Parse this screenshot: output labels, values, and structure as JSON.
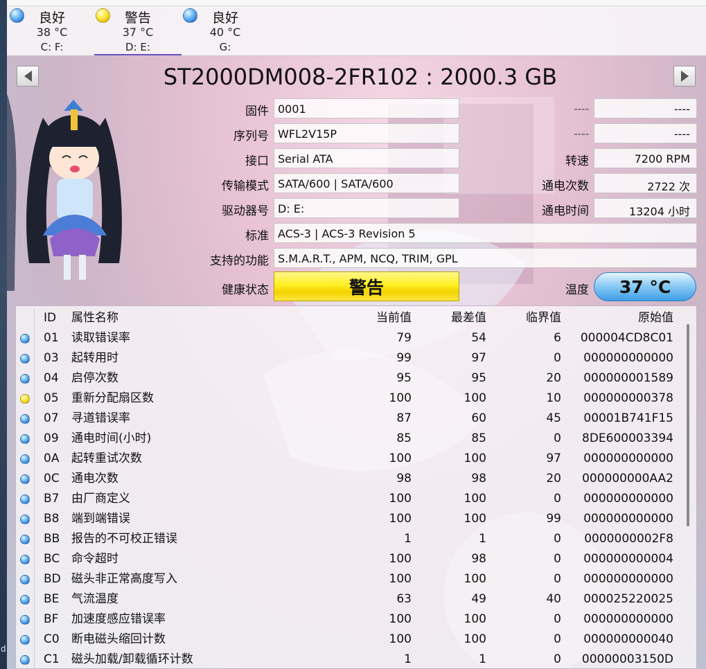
{
  "drives": [
    {
      "status": "良好",
      "temp": "38 °C",
      "letters": "C: F:",
      "state": "good",
      "color": "#3a8ae0"
    },
    {
      "status": "警告",
      "temp": "37 °C",
      "letters": "D: E:",
      "state": "warn",
      "color": "#f2d300",
      "active": true
    },
    {
      "status": "良好",
      "temp": "40 °C",
      "letters": "G:",
      "state": "good",
      "color": "#3a8ae0"
    }
  ],
  "disk_title": "ST2000DM008-2FR102 : 2000.3 GB",
  "info": {
    "firmware": {
      "label": "固件",
      "value": "0001"
    },
    "serial": {
      "label": "序列号",
      "value": "WFL2V15P"
    },
    "interface": {
      "label": "接口",
      "value": "Serial ATA"
    },
    "transfer": {
      "label": "传输模式",
      "value": "SATA/600 | SATA/600"
    },
    "drive_letter": {
      "label": "驱动器号",
      "value": "D: E:"
    },
    "standard": {
      "label": "标准",
      "value": "ACS-3 | ACS-3 Revision 5"
    },
    "features": {
      "label": "支持的功能",
      "value": "S.M.A.R.T., APM, NCQ, TRIM, GPL"
    },
    "right1": {
      "label": "----",
      "value": "----"
    },
    "right2": {
      "label": "----",
      "value": "----"
    },
    "rotation": {
      "label": "转速",
      "value": "7200 RPM"
    },
    "power_count": {
      "label": "通电次数",
      "value": "2722 次"
    },
    "power_hours": {
      "label": "通电时间",
      "value": "13204 小时"
    }
  },
  "health": {
    "label": "健康状态",
    "value": "警告",
    "color": "#ffef22"
  },
  "temperature": {
    "label": "温度",
    "value": "37 °C",
    "color": "#3e9ee8"
  },
  "smart_table": {
    "headers": {
      "id": "ID",
      "name": "属性名称",
      "current": "当前值",
      "worst": "最差值",
      "threshold": "临界值",
      "raw": "原始值"
    },
    "rows": [
      {
        "state": "good",
        "id": "01",
        "name": "读取错误率",
        "current": "79",
        "worst": "54",
        "threshold": "6",
        "raw": "000004CD8C01"
      },
      {
        "state": "good",
        "id": "03",
        "name": "起转用时",
        "current": "99",
        "worst": "97",
        "threshold": "0",
        "raw": "000000000000"
      },
      {
        "state": "good",
        "id": "04",
        "name": "启停次数",
        "current": "95",
        "worst": "95",
        "threshold": "20",
        "raw": "000000001589"
      },
      {
        "state": "warn",
        "id": "05",
        "name": "重新分配扇区数",
        "current": "100",
        "worst": "100",
        "threshold": "10",
        "raw": "000000000378"
      },
      {
        "state": "good",
        "id": "07",
        "name": "寻道错误率",
        "current": "87",
        "worst": "60",
        "threshold": "45",
        "raw": "00001B741F15"
      },
      {
        "state": "good",
        "id": "09",
        "name": "通电时间(小时)",
        "current": "85",
        "worst": "85",
        "threshold": "0",
        "raw": "8DE600003394"
      },
      {
        "state": "good",
        "id": "0A",
        "name": "起转重试次数",
        "current": "100",
        "worst": "100",
        "threshold": "97",
        "raw": "000000000000"
      },
      {
        "state": "good",
        "id": "0C",
        "name": "通电次数",
        "current": "98",
        "worst": "98",
        "threshold": "20",
        "raw": "000000000AA2"
      },
      {
        "state": "good",
        "id": "B7",
        "name": "由厂商定义",
        "current": "100",
        "worst": "100",
        "threshold": "0",
        "raw": "000000000000"
      },
      {
        "state": "good",
        "id": "B8",
        "name": "端到端错误",
        "current": "100",
        "worst": "100",
        "threshold": "99",
        "raw": "000000000000"
      },
      {
        "state": "good",
        "id": "BB",
        "name": "报告的不可校正错误",
        "current": "1",
        "worst": "1",
        "threshold": "0",
        "raw": "0000000002F8"
      },
      {
        "state": "good",
        "id": "BC",
        "name": "命令超时",
        "current": "100",
        "worst": "98",
        "threshold": "0",
        "raw": "000000000004"
      },
      {
        "state": "good",
        "id": "BD",
        "name": "磁头非正常高度写入",
        "current": "100",
        "worst": "100",
        "threshold": "0",
        "raw": "000000000000"
      },
      {
        "state": "good",
        "id": "BE",
        "name": "气流温度",
        "current": "63",
        "worst": "49",
        "threshold": "40",
        "raw": "000025220025"
      },
      {
        "state": "good",
        "id": "BF",
        "name": "加速度感应错误率",
        "current": "100",
        "worst": "100",
        "threshold": "0",
        "raw": "000000000000"
      },
      {
        "state": "good",
        "id": "C0",
        "name": "断电磁头缩回计数",
        "current": "100",
        "worst": "100",
        "threshold": "0",
        "raw": "000000000040"
      },
      {
        "state": "good",
        "id": "C1",
        "name": "磁头加载/卸载循环计数",
        "current": "1",
        "worst": "1",
        "threshold": "0",
        "raw": "00000003150D"
      }
    ]
  }
}
